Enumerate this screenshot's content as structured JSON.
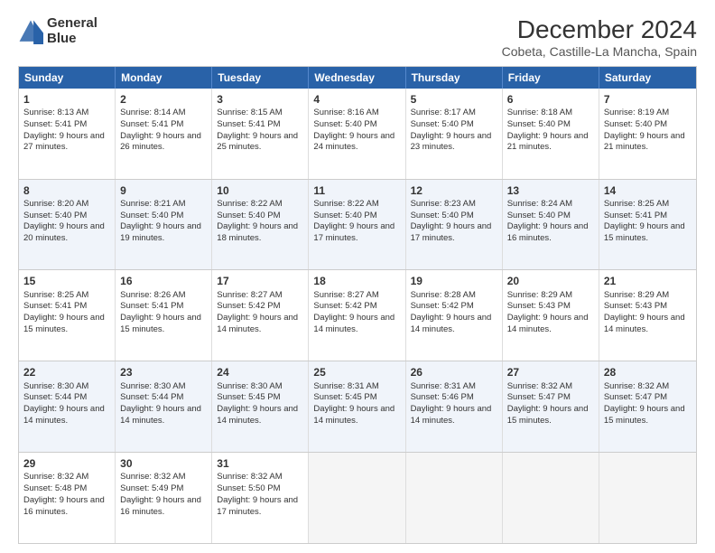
{
  "header": {
    "logo_line1": "General",
    "logo_line2": "Blue",
    "title": "December 2024",
    "subtitle": "Cobeta, Castille-La Mancha, Spain"
  },
  "weekdays": [
    "Sunday",
    "Monday",
    "Tuesday",
    "Wednesday",
    "Thursday",
    "Friday",
    "Saturday"
  ],
  "rows": [
    [
      {
        "day": "1",
        "info": "Sunrise: 8:13 AM\nSunset: 5:41 PM\nDaylight: 9 hours and 27 minutes."
      },
      {
        "day": "2",
        "info": "Sunrise: 8:14 AM\nSunset: 5:41 PM\nDaylight: 9 hours and 26 minutes."
      },
      {
        "day": "3",
        "info": "Sunrise: 8:15 AM\nSunset: 5:41 PM\nDaylight: 9 hours and 25 minutes."
      },
      {
        "day": "4",
        "info": "Sunrise: 8:16 AM\nSunset: 5:40 PM\nDaylight: 9 hours and 24 minutes."
      },
      {
        "day": "5",
        "info": "Sunrise: 8:17 AM\nSunset: 5:40 PM\nDaylight: 9 hours and 23 minutes."
      },
      {
        "day": "6",
        "info": "Sunrise: 8:18 AM\nSunset: 5:40 PM\nDaylight: 9 hours and 21 minutes."
      },
      {
        "day": "7",
        "info": "Sunrise: 8:19 AM\nSunset: 5:40 PM\nDaylight: 9 hours and 21 minutes."
      }
    ],
    [
      {
        "day": "8",
        "info": "Sunrise: 8:20 AM\nSunset: 5:40 PM\nDaylight: 9 hours and 20 minutes."
      },
      {
        "day": "9",
        "info": "Sunrise: 8:21 AM\nSunset: 5:40 PM\nDaylight: 9 hours and 19 minutes."
      },
      {
        "day": "10",
        "info": "Sunrise: 8:22 AM\nSunset: 5:40 PM\nDaylight: 9 hours and 18 minutes."
      },
      {
        "day": "11",
        "info": "Sunrise: 8:22 AM\nSunset: 5:40 PM\nDaylight: 9 hours and 17 minutes."
      },
      {
        "day": "12",
        "info": "Sunrise: 8:23 AM\nSunset: 5:40 PM\nDaylight: 9 hours and 17 minutes."
      },
      {
        "day": "13",
        "info": "Sunrise: 8:24 AM\nSunset: 5:40 PM\nDaylight: 9 hours and 16 minutes."
      },
      {
        "day": "14",
        "info": "Sunrise: 8:25 AM\nSunset: 5:41 PM\nDaylight: 9 hours and 15 minutes."
      }
    ],
    [
      {
        "day": "15",
        "info": "Sunrise: 8:25 AM\nSunset: 5:41 PM\nDaylight: 9 hours and 15 minutes."
      },
      {
        "day": "16",
        "info": "Sunrise: 8:26 AM\nSunset: 5:41 PM\nDaylight: 9 hours and 15 minutes."
      },
      {
        "day": "17",
        "info": "Sunrise: 8:27 AM\nSunset: 5:42 PM\nDaylight: 9 hours and 14 minutes."
      },
      {
        "day": "18",
        "info": "Sunrise: 8:27 AM\nSunset: 5:42 PM\nDaylight: 9 hours and 14 minutes."
      },
      {
        "day": "19",
        "info": "Sunrise: 8:28 AM\nSunset: 5:42 PM\nDaylight: 9 hours and 14 minutes."
      },
      {
        "day": "20",
        "info": "Sunrise: 8:29 AM\nSunset: 5:43 PM\nDaylight: 9 hours and 14 minutes."
      },
      {
        "day": "21",
        "info": "Sunrise: 8:29 AM\nSunset: 5:43 PM\nDaylight: 9 hours and 14 minutes."
      }
    ],
    [
      {
        "day": "22",
        "info": "Sunrise: 8:30 AM\nSunset: 5:44 PM\nDaylight: 9 hours and 14 minutes."
      },
      {
        "day": "23",
        "info": "Sunrise: 8:30 AM\nSunset: 5:44 PM\nDaylight: 9 hours and 14 minutes."
      },
      {
        "day": "24",
        "info": "Sunrise: 8:30 AM\nSunset: 5:45 PM\nDaylight: 9 hours and 14 minutes."
      },
      {
        "day": "25",
        "info": "Sunrise: 8:31 AM\nSunset: 5:45 PM\nDaylight: 9 hours and 14 minutes."
      },
      {
        "day": "26",
        "info": "Sunrise: 8:31 AM\nSunset: 5:46 PM\nDaylight: 9 hours and 14 minutes."
      },
      {
        "day": "27",
        "info": "Sunrise: 8:32 AM\nSunset: 5:47 PM\nDaylight: 9 hours and 15 minutes."
      },
      {
        "day": "28",
        "info": "Sunrise: 8:32 AM\nSunset: 5:47 PM\nDaylight: 9 hours and 15 minutes."
      }
    ],
    [
      {
        "day": "29",
        "info": "Sunrise: 8:32 AM\nSunset: 5:48 PM\nDaylight: 9 hours and 16 minutes."
      },
      {
        "day": "30",
        "info": "Sunrise: 8:32 AM\nSunset: 5:49 PM\nDaylight: 9 hours and 16 minutes."
      },
      {
        "day": "31",
        "info": "Sunrise: 8:32 AM\nSunset: 5:50 PM\nDaylight: 9 hours and 17 minutes."
      },
      {
        "day": "",
        "info": ""
      },
      {
        "day": "",
        "info": ""
      },
      {
        "day": "",
        "info": ""
      },
      {
        "day": "",
        "info": ""
      }
    ]
  ]
}
